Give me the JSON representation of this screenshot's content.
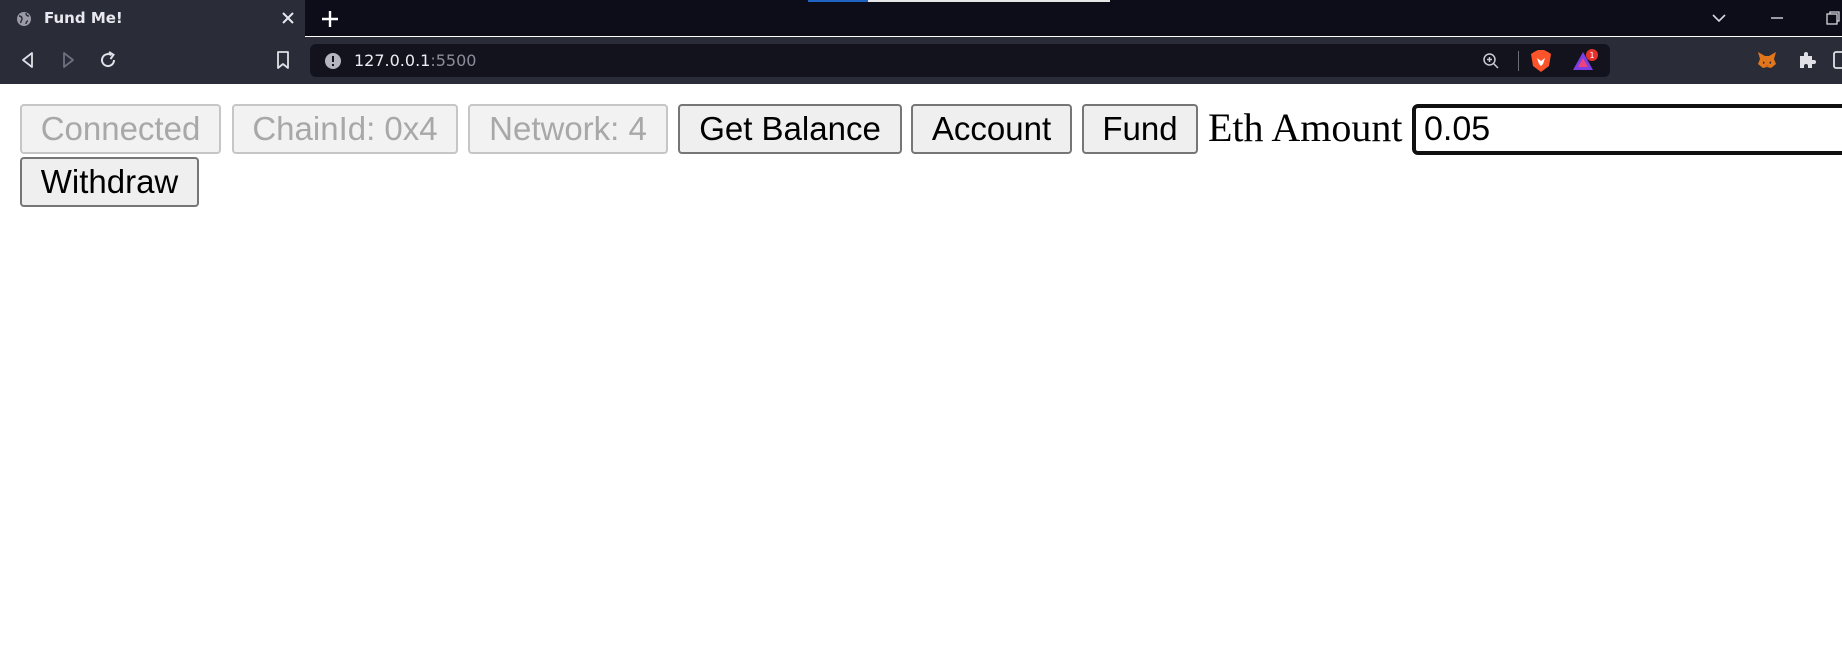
{
  "browser": {
    "tab_title": "Fund Me!",
    "url_host": "127.0.0.1",
    "url_port": ":5500",
    "rewards_badge": "1"
  },
  "page": {
    "buttons": {
      "connected": "Connected",
      "chain_id": "ChainId: 0x4",
      "network": "Network: 4",
      "get_balance": "Get Balance",
      "account": "Account",
      "fund": "Fund",
      "withdraw": "Withdraw"
    },
    "eth_amount_label": "Eth Amount",
    "eth_amount_value": "0.05"
  },
  "colors": {
    "chrome_bg": "#0c0d18",
    "toolbar_bg": "#2a2c38",
    "urlbar_bg": "#12131c",
    "brave_orange": "#fb542b",
    "rewards_purple": "#7b3fe4"
  }
}
